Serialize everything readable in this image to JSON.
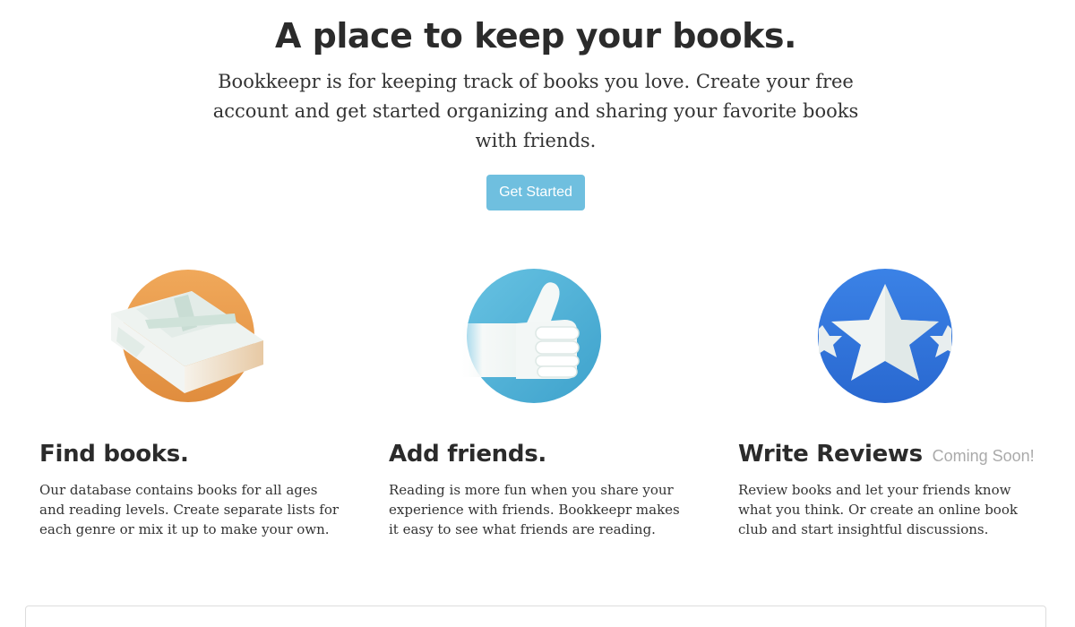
{
  "hero": {
    "title": "A place to keep your books.",
    "lead": "Bookkeepr is for keeping track of books you love. Create your free account and get started organizing and sharing your favorite books with friends.",
    "cta_label": "Get Started"
  },
  "features": [
    {
      "icon": "book-icon",
      "title": "Find books.",
      "badge": "",
      "text": "Our database contains books for all ages and reading levels. Create separate lists for each genre or mix it up to make your own."
    },
    {
      "icon": "thumbs-up-icon",
      "title": "Add friends.",
      "badge": "",
      "text": "Reading is more fun when you share your experience with friends. Bookkeepr makes it easy to see what friends are reading."
    },
    {
      "icon": "star-icon",
      "title": "Write Reviews",
      "badge": "Coming Soon!",
      "text": "Review books and let your friends know what you think. Or create an online book club and start insightful discussions."
    }
  ],
  "colors": {
    "cta": "#6fbfdf",
    "book_circle": "#e89a4c",
    "thumb_circle": "#4fb1d6",
    "star_circle": "#2f78dc",
    "heading": "#2b2b2b",
    "muted": "#aaaaaa"
  }
}
